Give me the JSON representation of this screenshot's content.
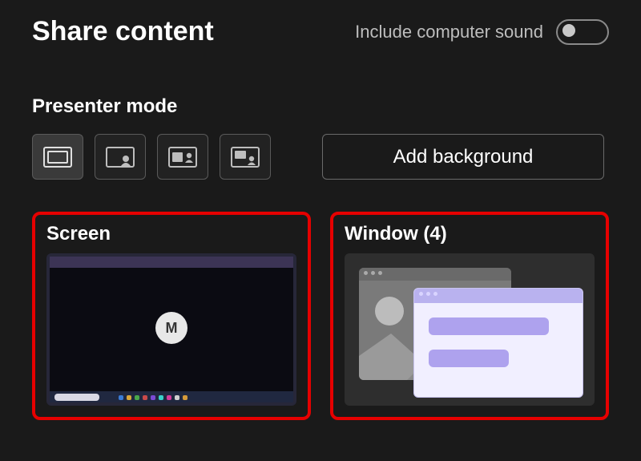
{
  "header": {
    "title": "Share content",
    "sound_label": "Include computer sound",
    "sound_on": false
  },
  "presenter": {
    "label": "Presenter mode",
    "modes": [
      {
        "id": "content-only",
        "selected": true
      },
      {
        "id": "standout",
        "selected": false
      },
      {
        "id": "side-by-side",
        "selected": false
      },
      {
        "id": "reporter",
        "selected": false
      }
    ],
    "add_background_label": "Add background"
  },
  "cards": {
    "screen": {
      "title": "Screen",
      "avatar_letter": "M"
    },
    "window": {
      "title": "Window (4)"
    }
  }
}
